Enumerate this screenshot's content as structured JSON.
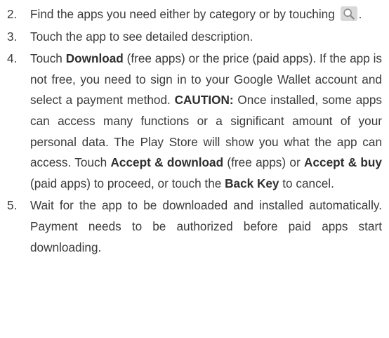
{
  "steps": [
    {
      "number": "2.",
      "text_before_icon": "Find the apps you need either by category or by touching",
      "icon": "search-icon",
      "text_after_icon": "."
    },
    {
      "number": "3.",
      "text": "Touch the app to see detailed description."
    },
    {
      "number": "4.",
      "t1": "Touch ",
      "b1": "Download",
      "t2": " (free apps) or the price (paid apps). If the app is not free, you need to sign in to your Google Wallet account and select a payment method. ",
      "b2": "CAUTION:",
      "t3": " Once installed, some apps can access many functions or a significant amount of your personal data. The Play Store will show you what the app can access. Touch ",
      "b3": "Accept & download",
      "t4": " (free apps) or ",
      "b4": "Accept & buy",
      "t5": " (paid apps) to proceed, or touch the ",
      "b5": "Back Key",
      "t6": " to cancel."
    },
    {
      "number": "5.",
      "text": "Wait for the app to be downloaded and installed automatically. Payment needs to be authorized before paid apps start downloading."
    }
  ],
  "colors": {
    "text": "#3a3a3a",
    "icon_background": "#d9d9d9",
    "icon_stroke": "#8a8a8a"
  }
}
